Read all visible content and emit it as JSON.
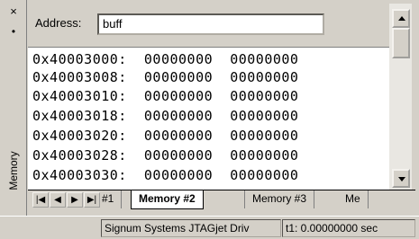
{
  "window": {
    "close_glyph": "×",
    "pin_glyph": "•",
    "panel_title": "Memory"
  },
  "address": {
    "label": "Address:",
    "value": "buff"
  },
  "memory": {
    "rows": [
      "0x40003000:  00000000  00000000",
      "0x40003008:  00000000  00000000",
      "0x40003010:  00000000  00000000",
      "0x40003018:  00000000  00000000",
      "0x40003020:  00000000  00000000",
      "0x40003028:  00000000  00000000",
      "0x40003030:  00000000  00000000"
    ]
  },
  "tabs": {
    "nav": [
      "|◀",
      "◀",
      "▶",
      "▶|"
    ],
    "items": [
      {
        "label": "#1",
        "active": false
      },
      {
        "label": "Memory #2",
        "active": true
      },
      {
        "label": "Memory #3",
        "active": false
      },
      {
        "label": "Me",
        "active": false
      }
    ]
  },
  "status": {
    "connection": "Signum Systems JTAGjet Driv",
    "time": "t1: 0.00000000 sec"
  }
}
